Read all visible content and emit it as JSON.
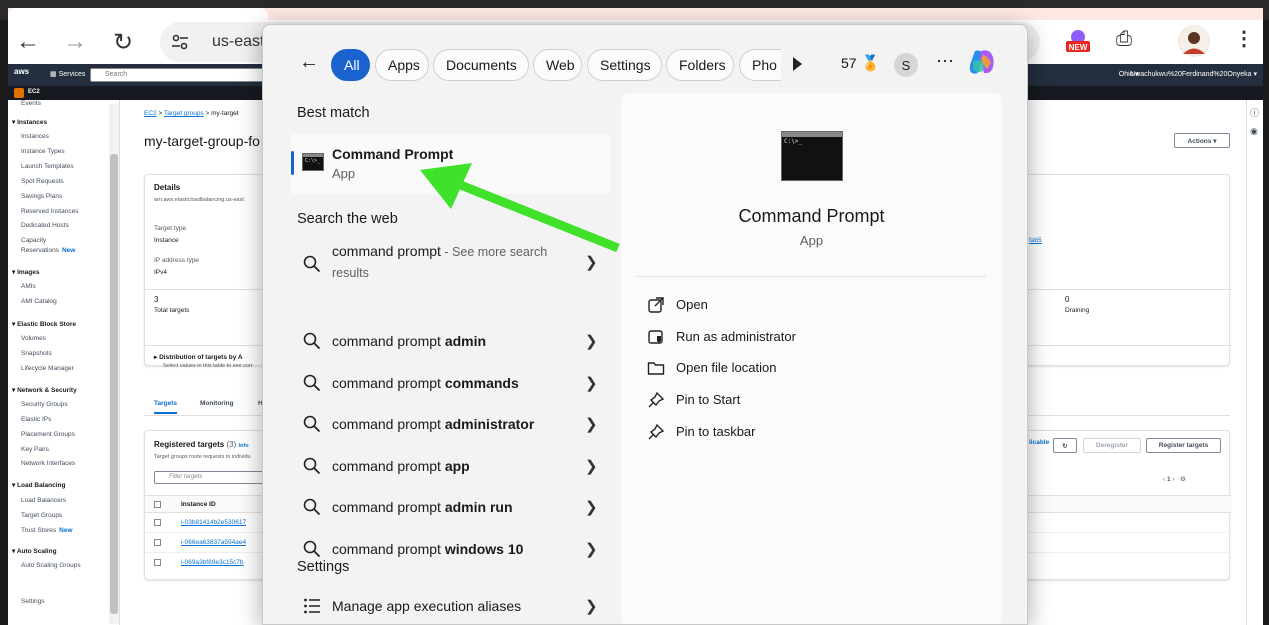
{
  "browser": {
    "url": "us-east-",
    "new_badge": "NEW"
  },
  "aws": {
    "logo": "aws",
    "services": "Services",
    "search_placeholder": "Search",
    "region": "Ohio ▾",
    "user": "Nwachukwu%20Ferdinand%20Onyeka ▾",
    "service_badge": "EC2",
    "sidebar": {
      "top_cut": "Events",
      "sections": [
        {
          "title": "Instances",
          "items": [
            "Instances",
            "Instance Types",
            "Launch Templates",
            "Spot Requests",
            "Savings Plans",
            "Reserved Instances",
            "Dedicated Hosts",
            "Capacity",
            "Reservations"
          ]
        },
        {
          "title": "Images",
          "items": [
            "AMIs",
            "AMI Catalog"
          ]
        },
        {
          "title": "Elastic Block Store",
          "items": [
            "Volumes",
            "Snapshots",
            "Lifecycle Manager"
          ]
        },
        {
          "title": "Network & Security",
          "items": [
            "Security Groups",
            "Elastic IPs",
            "Placement Groups",
            "Key Pairs",
            "Network Interfaces"
          ]
        },
        {
          "title": "Load Balancing",
          "items": [
            "Load Balancers",
            "Target Groups",
            "Trust Stores"
          ]
        },
        {
          "title": "Auto Scaling",
          "items": [
            "Auto Scaling Groups"
          ]
        }
      ],
      "new_label": "New",
      "settings": "Settings"
    },
    "breadcrumb": {
      "ec2": "EC2",
      "sep": ">",
      "target_groups": "Target groups",
      "current": "my-target"
    },
    "page_title": "my-target-group-fo",
    "actions": "Actions ▾",
    "details": {
      "title": "Details",
      "arn": "arn:aws:elasticloadbalancing:us-east",
      "target_type_label": "Target type",
      "target_type_value": "Instance",
      "ip_label": "IP address type",
      "ip_value": "IPv4",
      "total_targets_value": "3",
      "total_targets_label": "Total targets",
      "draining_value": "0",
      "draining_label": "Draining",
      "lb_link": "fab5",
      "distribution_title": "Distribution of targets by A",
      "distribution_sub": "Select values in this table to see corr"
    },
    "tabs": [
      "Targets",
      "Monitoring",
      "H"
    ],
    "registered": {
      "title": "Registered targets",
      "count": "(3)",
      "info": "Info",
      "sub": "Target groups route requests to individu",
      "filter_placeholder": "Filter targets",
      "col_instance": "Instance ID",
      "rows": [
        "i-03b81414b2e530617",
        "i-066ea63837a594ae4",
        "i-069a3bf89e3c15c7b"
      ],
      "anomaly_link": "licable",
      "deregister": "Deregister",
      "register": "Register targets",
      "page": "1"
    }
  },
  "search": {
    "filters": [
      "All",
      "Apps",
      "Documents",
      "Web",
      "Settings",
      "Folders",
      "Pho"
    ],
    "points": "57",
    "avatar": "S",
    "best_match_header": "Best match",
    "best_match": {
      "title": "Command Prompt",
      "subtitle": "App"
    },
    "web_header": "Search the web",
    "web_first": {
      "query": "command prompt",
      "hint": " - See more search results"
    },
    "web_results": [
      {
        "prefix": "command prompt ",
        "bold": "admin"
      },
      {
        "prefix": "command prompt ",
        "bold": "commands"
      },
      {
        "prefix": "command prompt ",
        "bold": "administrator"
      },
      {
        "prefix": "command prompt ",
        "bold": "app"
      },
      {
        "prefix": "command prompt ",
        "bold": "admin run"
      },
      {
        "prefix": "command prompt ",
        "bold": "windows 10"
      }
    ],
    "settings_header": "Settings",
    "settings_result": "Manage app execution aliases",
    "detail": {
      "name": "Command Prompt",
      "type": "App",
      "actions": [
        "Open",
        "Run as administrator",
        "Open file location",
        "Pin to Start",
        "Pin to taskbar"
      ]
    },
    "cmd_glyph": "C:\\>_"
  },
  "colors": {
    "accent": "#1a63cf",
    "arrow": "#3fe12a",
    "aws_header": "#232f3e",
    "aws_link": "#0972d3"
  }
}
